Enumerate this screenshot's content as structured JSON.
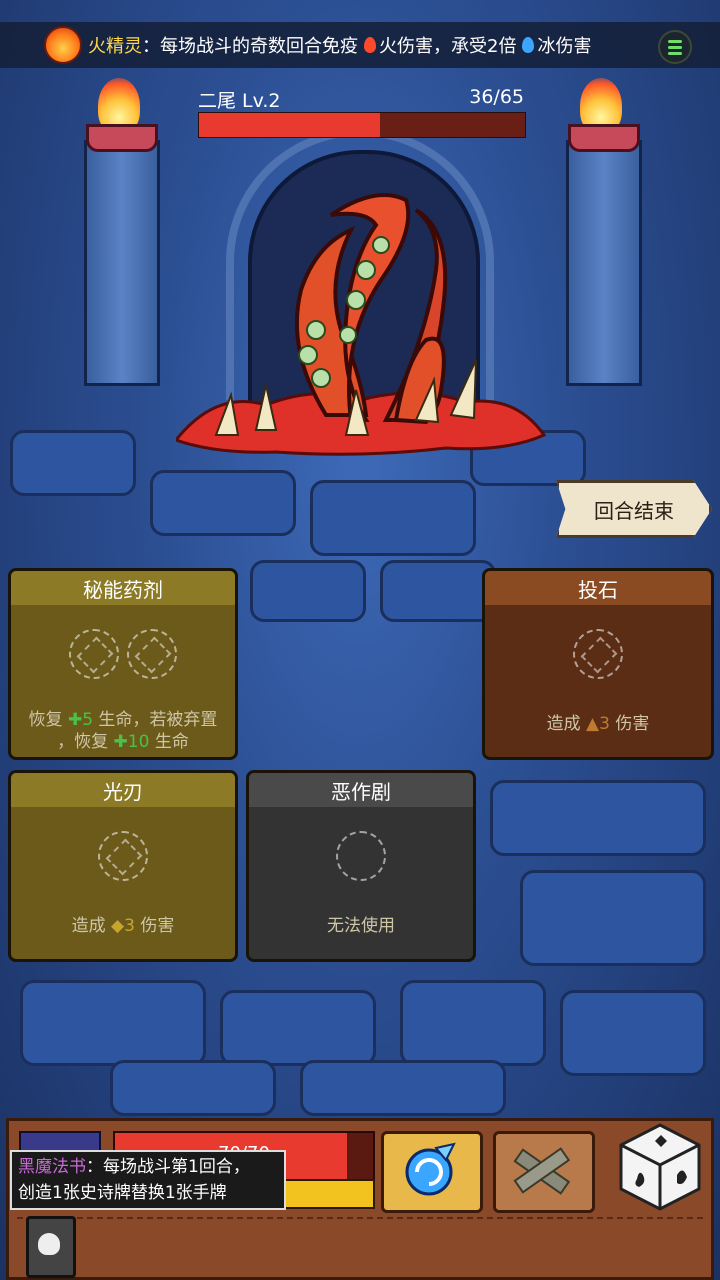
{
  "top_banner": {
    "relic_name": "火精灵",
    "colon": "：",
    "text_part1": "每场战斗的奇数回合免疫",
    "fire_word": "火伤害，承受2倍",
    "ice_word": "冰伤害"
  },
  "enemy": {
    "name": "二尾  Lv.2",
    "hp_text": "36/65",
    "hp_fraction": 0.554
  },
  "end_turn": {
    "label": "回合结束"
  },
  "cards": [
    {
      "id": "card-1",
      "title": "秘能药剂",
      "desc_line1_a": "恢复 ",
      "desc_line1_num": "5",
      "desc_line1_b": " 生命，若被弃置",
      "desc_line2_a": "，恢复 ",
      "desc_line2_num": "10",
      "desc_line2_b": " 生命",
      "color": "#6b5a1a"
    },
    {
      "id": "card-2",
      "title": "投石",
      "desc_a": "造成 ",
      "desc_num": "3",
      "desc_b": " 伤害",
      "color": "#5a2d14"
    },
    {
      "id": "card-3",
      "title": "光刃",
      "desc_a": "造成 ",
      "desc_num": "3",
      "desc_b": " 伤害",
      "color": "#6b5a1a"
    },
    {
      "id": "card-4",
      "title": "恶作剧",
      "desc": "无法使用",
      "color": "#333333"
    }
  ],
  "player": {
    "hp_text": "70/70",
    "hp_fraction": 0.9,
    "shield_text": "0",
    "shield_fraction": 1.0
  },
  "relic_tooltip": {
    "title": "黑魔法书",
    "colon": "：",
    "line1": "每场战斗第1回合，",
    "line2": "创造1张史诗牌替换1张手牌"
  },
  "icons": {
    "top_left": "fire-spirit-icon",
    "menu": "menu-icon",
    "dice": "dice-icon",
    "skill1": "swirl-icon",
    "skill2": "crossed-bandage-icon",
    "book": "black-magic-book-icon"
  },
  "colors": {
    "enemy_hp": "#e83a2e",
    "player_hp": "#e83a2e",
    "shield": "#f2c21e",
    "tooltip_title": "#c96ad8"
  }
}
